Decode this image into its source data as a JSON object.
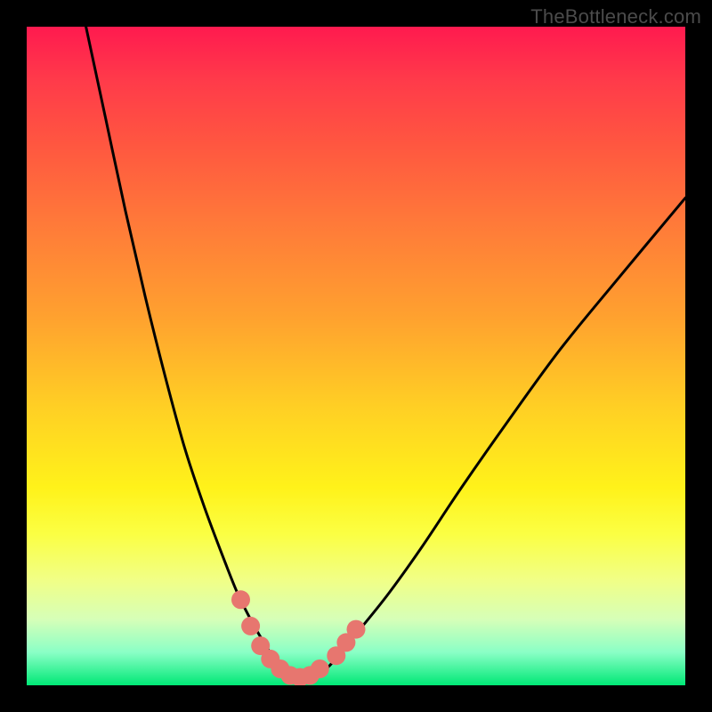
{
  "watermark": "TheBottleneck.com",
  "colors": {
    "curve": "#000000",
    "marker_fill": "#e7766f",
    "bg_top": "#ff1a4f",
    "bg_bottom": "#00e876",
    "frame": "#000000"
  },
  "chart_data": {
    "type": "line",
    "title": "",
    "xlabel": "",
    "ylabel": "",
    "xlim": [
      0,
      100
    ],
    "ylim": [
      0,
      100
    ],
    "x_min_at": 40,
    "curve_description": "V-shaped bottleneck curve: steep drop on left side, minimum around x≈40 near y≈0, gentler rise on right side",
    "series": [
      {
        "name": "bottleneck-curve",
        "x": [
          9,
          12,
          15,
          18,
          21,
          24,
          27,
          30,
          32,
          34,
          36,
          38,
          40,
          42,
          44,
          46,
          48,
          51,
          55,
          60,
          66,
          73,
          81,
          90,
          100
        ],
        "y": [
          100,
          86,
          72,
          59,
          47,
          36,
          27,
          19,
          14,
          10,
          6.5,
          3.5,
          1.5,
          1,
          1.5,
          3,
          5.5,
          9,
          14,
          21,
          30,
          40,
          51,
          62,
          74
        ]
      }
    ],
    "markers": {
      "name": "highlighted-points",
      "color": "#e7766f",
      "points": [
        {
          "x": 32.5,
          "y": 13
        },
        {
          "x": 34,
          "y": 9
        },
        {
          "x": 35.5,
          "y": 6
        },
        {
          "x": 37,
          "y": 4
        },
        {
          "x": 38.5,
          "y": 2.5
        },
        {
          "x": 40,
          "y": 1.5
        },
        {
          "x": 41.5,
          "y": 1.2
        },
        {
          "x": 43,
          "y": 1.5
        },
        {
          "x": 44.5,
          "y": 2.5
        },
        {
          "x": 47,
          "y": 4.5
        },
        {
          "x": 48.5,
          "y": 6.5
        },
        {
          "x": 50,
          "y": 8.5
        }
      ]
    }
  }
}
